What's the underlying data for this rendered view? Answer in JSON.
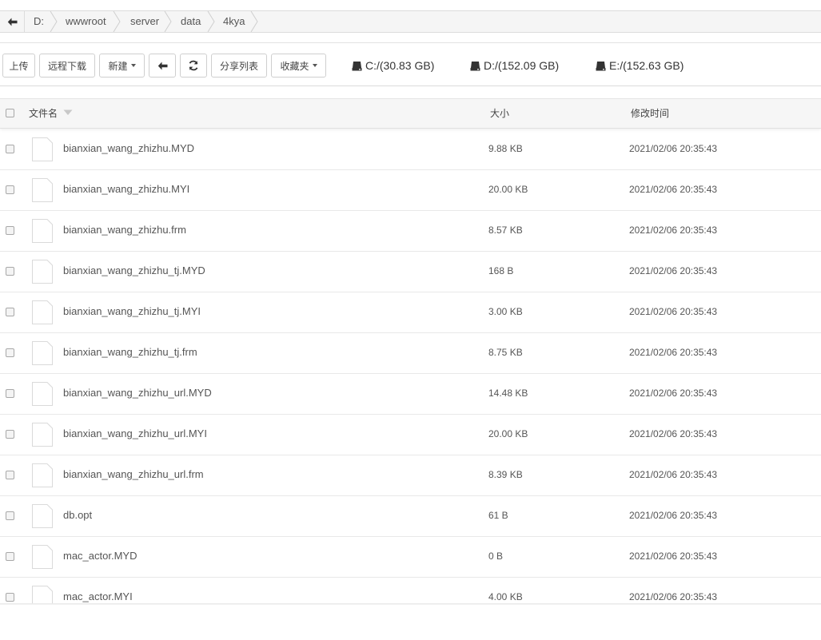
{
  "breadcrumb": {
    "items": [
      "D:",
      "wwwroot",
      "server",
      "data",
      "4kya"
    ]
  },
  "toolbar": {
    "upload_label": "上传",
    "remote_download_label": "远程下载",
    "new_label": "新建",
    "share_list_label": "分享列表",
    "favorites_label": "收藏夹"
  },
  "disks": [
    {
      "label": "C:/(30.83 GB)"
    },
    {
      "label": "D:/(152.09 GB)"
    },
    {
      "label": "E:/(152.63 GB)"
    }
  ],
  "table": {
    "columns": {
      "name": "文件名",
      "size": "大小",
      "modified": "修改时间"
    },
    "rows": [
      {
        "name": "bianxian_wang_zhizhu.MYD",
        "size": "9.88 KB",
        "modified": "2021/02/06 20:35:43"
      },
      {
        "name": "bianxian_wang_zhizhu.MYI",
        "size": "20.00 KB",
        "modified": "2021/02/06 20:35:43"
      },
      {
        "name": "bianxian_wang_zhizhu.frm",
        "size": "8.57 KB",
        "modified": "2021/02/06 20:35:43"
      },
      {
        "name": "bianxian_wang_zhizhu_tj.MYD",
        "size": "168 B",
        "modified": "2021/02/06 20:35:43"
      },
      {
        "name": "bianxian_wang_zhizhu_tj.MYI",
        "size": "3.00 KB",
        "modified": "2021/02/06 20:35:43"
      },
      {
        "name": "bianxian_wang_zhizhu_tj.frm",
        "size": "8.75 KB",
        "modified": "2021/02/06 20:35:43"
      },
      {
        "name": "bianxian_wang_zhizhu_url.MYD",
        "size": "14.48 KB",
        "modified": "2021/02/06 20:35:43"
      },
      {
        "name": "bianxian_wang_zhizhu_url.MYI",
        "size": "20.00 KB",
        "modified": "2021/02/06 20:35:43"
      },
      {
        "name": "bianxian_wang_zhizhu_url.frm",
        "size": "8.39 KB",
        "modified": "2021/02/06 20:35:43"
      },
      {
        "name": "db.opt",
        "size": "61 B",
        "modified": "2021/02/06 20:35:43"
      },
      {
        "name": "mac_actor.MYD",
        "size": "0 B",
        "modified": "2021/02/06 20:35:43"
      },
      {
        "name": "mac_actor.MYI",
        "size": "4.00 KB",
        "modified": "2021/02/06 20:35:43"
      }
    ]
  }
}
